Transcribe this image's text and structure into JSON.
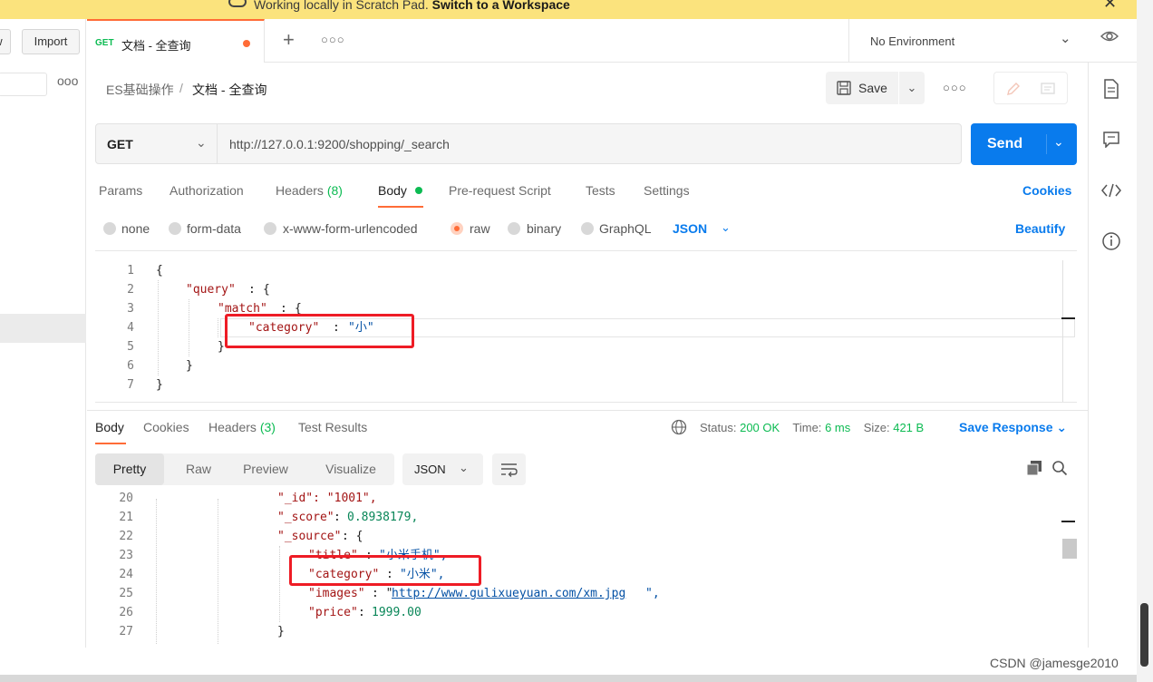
{
  "banner": {
    "text": "Working locally in Scratch Pad.",
    "link": "Switch to a Workspace",
    "close": "✕"
  },
  "sidebar": {
    "new_label": "w",
    "import_label": "Import"
  },
  "tab": {
    "method": "GET",
    "title": "文档 - 全查询",
    "add_icon": "+",
    "more_icon": "○○○"
  },
  "environment": {
    "label": "No Environment"
  },
  "breadcrumb": {
    "parent": "ES基础操作",
    "separator": "/",
    "current": "文档 - 全查询"
  },
  "toolbar": {
    "save_label": "Save",
    "more_icon": "○○○"
  },
  "request": {
    "method": "GET",
    "url": "http://127.0.0.1:9200/shopping/_search",
    "send_label": "Send"
  },
  "request_tabs": [
    {
      "label": "Params"
    },
    {
      "label": "Authorization"
    },
    {
      "label": "Headers",
      "count": "(8)"
    },
    {
      "label": "Body"
    },
    {
      "label": "Pre-request Script"
    },
    {
      "label": "Tests"
    },
    {
      "label": "Settings"
    }
  ],
  "cookies_label": "Cookies",
  "body_types": [
    {
      "label": "none",
      "selected": false
    },
    {
      "label": "form-data",
      "selected": false
    },
    {
      "label": "x-www-form-urlencoded",
      "selected": false
    },
    {
      "label": "raw",
      "selected": true
    },
    {
      "label": "binary",
      "selected": false
    },
    {
      "label": "GraphQL",
      "selected": false
    }
  ],
  "body_format": "JSON",
  "beautify_label": "Beautify",
  "editor": {
    "line_numbers": [
      "1",
      "2",
      "3",
      "4",
      "5",
      "6",
      "7"
    ],
    "open_brace": "{",
    "close_brace": "}",
    "query_key": "\"query\"",
    "match_key": "\"match\"",
    "category_key": "\"category\"",
    "category_value": "\"小\"",
    "colon": ":"
  },
  "response_tabs": [
    {
      "label": "Body"
    },
    {
      "label": "Cookies"
    },
    {
      "label": "Headers",
      "count": "(3)"
    },
    {
      "label": "Test Results"
    }
  ],
  "response_status": {
    "status_label": "Status:",
    "status_value": "200 OK",
    "time_label": "Time:",
    "time_value": "6 ms",
    "size_label": "Size:",
    "size_value": "421 B"
  },
  "save_response_label": "Save Response",
  "view_modes": [
    "Pretty",
    "Raw",
    "Preview",
    "Visualize"
  ],
  "response_format": "JSON",
  "response_code": {
    "line_numbers": [
      "20",
      "21",
      "22",
      "23",
      "24",
      "25",
      "26",
      "27"
    ],
    "id_line": "\"_id\": \"1001\",",
    "score_key": "\"_score\"",
    "score_value": "0.8938179,",
    "source_key": "\"_source\"",
    "title_key": "\"title\"",
    "title_value": "\"小米手机\",",
    "category_key": "\"category\"",
    "category_value": "\"小米\",",
    "images_key": "\"images\"",
    "images_value": "http://www.gulixueyuan.com/xm.jpg",
    "price_key": "\"price\"",
    "price_value": "1999.00",
    "close_brace": "}"
  },
  "watermark": "CSDN @jamesge2010",
  "colors": {
    "accent": "#ff6c37",
    "primary": "#097bed",
    "success": "#0cbb52",
    "highlight_box": "#ee1c25",
    "banner": "#fbe37d"
  }
}
